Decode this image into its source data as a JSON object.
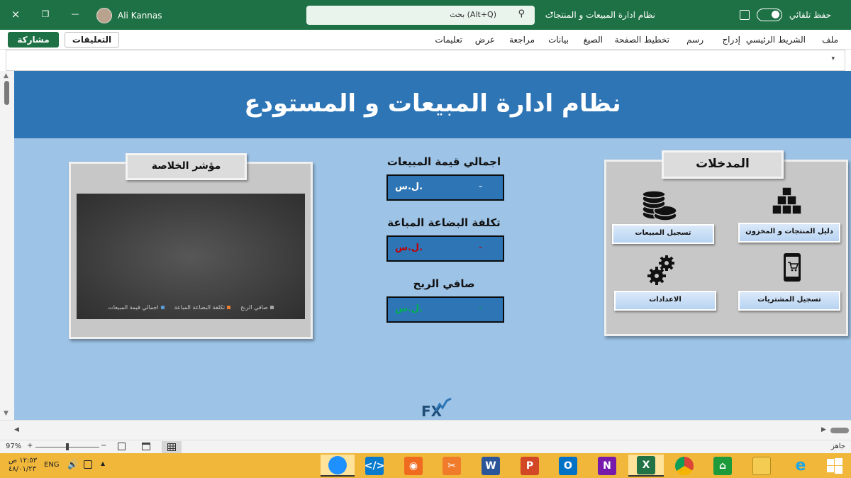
{
  "titlebar": {
    "user_name": "Ali Kannas",
    "search_placeholder": "بحث (Alt+Q)",
    "document_title": "نظام ادارة المبيعات و المنتجات",
    "autosave_label": "حفظ تلقائي",
    "close_icon": "×",
    "restore_icon": "❐",
    "minimize_icon": "—",
    "search_icon": "⚲",
    "caret": "▾"
  },
  "ribbon": {
    "tabs": [
      "ملف",
      "الشريط الرئيسي",
      "إدراج",
      "رسم",
      "تخطيط الصفحة",
      "الصيغ",
      "بيانات",
      "مراجعة",
      "عرض",
      "تعليمات"
    ],
    "comments_label": "التعليقات",
    "share_label": "مشاركة"
  },
  "sheet": {
    "title": "نظام ادارة المبيعات و المستودع",
    "inputs_panel": {
      "title": "المدخلات",
      "buttons": {
        "products": "دليل المنتجات و المخزون",
        "sales": "تسجيل المبيعات",
        "purchases": "تسجيل المشتريات",
        "settings": "الاعدادات"
      }
    },
    "kpis": [
      {
        "label": "اجمالي قيمة المبيعات",
        "currency": "ل.س.",
        "value": "-",
        "color": "#ffffff"
      },
      {
        "label": "تكلفة البضاعة المباعة",
        "currency": "ل.س.",
        "value": "-",
        "color": "#c00000"
      },
      {
        "label": "صافي الربح",
        "currency": "ل.س.",
        "value": "-",
        "color": "#00b050"
      }
    ],
    "summary_panel": {
      "title": "مؤشر الخلاصة",
      "legend": [
        {
          "name": "صافي الربح",
          "color": "#a5a5a5"
        },
        {
          "name": "تكلفة البضاعة المباعة",
          "color": "#ed7d31"
        },
        {
          "name": "اجمالي قيمة المبيعات",
          "color": "#5b9bd5"
        }
      ]
    },
    "logo_text": "FX"
  },
  "statusbar": {
    "ready": "جاهز",
    "zoom": "97%",
    "minus": "−",
    "plus": "+"
  },
  "taskbar": {
    "lang": "ENG",
    "time": "١٢:٥٣ ص",
    "date": "٤٨/٠١/٢٣"
  }
}
